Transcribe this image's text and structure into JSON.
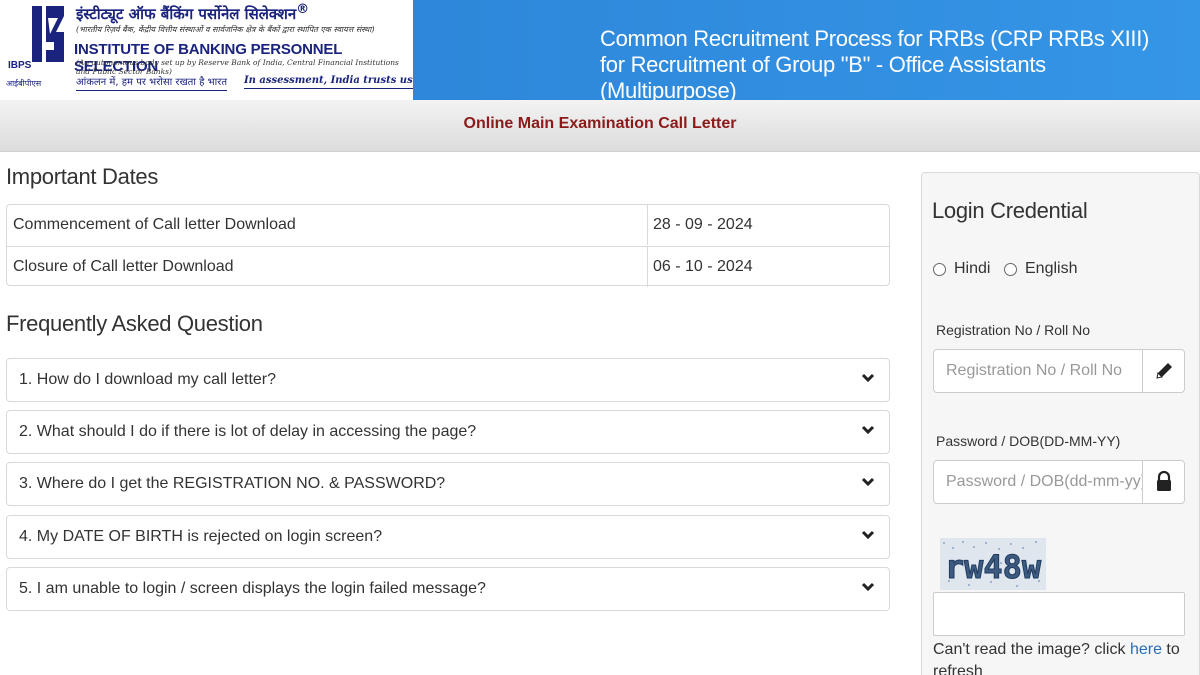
{
  "header": {
    "logo": {
      "hindi_name": "इंस्टीट्यूट ऑफ बैंकिंग पर्सोनेल सिलेक्शन",
      "registered_mark": "®",
      "hindi_subtitle": "(भारतीय रिज़र्व बैंक, केंद्रीय वित्तीय संस्थाओं व सार्वजनिक क्षेत्र के बैंकों द्वारा स्थापित एक स्वायत्त संस्था)",
      "english_name": "INSTITUTE OF BANKING PERSONNEL SELECTION",
      "english_subtitle": "(An autonomous body set up by Reserve Bank of India, Central Financial Institutions and Public Sector Banks)",
      "hindi_tagline": "आंकलन में, हम पर भरोसा रखता है भारत",
      "english_tagline": "In assessment, India trusts us",
      "short_name": "IBPS",
      "short_name_hindi": "आईबीपीएस"
    },
    "title": "Common Recruitment Process for RRBs (CRP RRBs XIII) for Recruitment of Group \"B\" - Office Assistants (Multipurpose)"
  },
  "subheader": {
    "title": "Online Main Examination Call Letter"
  },
  "important_dates": {
    "heading": "Important Dates",
    "rows": [
      {
        "label": "Commencement of Call letter Download",
        "date": "28 - 09 - 2024"
      },
      {
        "label": "Closure of Call letter Download",
        "date": "06 - 10 - 2024"
      }
    ]
  },
  "faq": {
    "heading": "Frequently Asked Question",
    "items": [
      "1. How do I download my call letter?",
      "2. What should I do if there is lot of delay in accessing the page?",
      "3. Where do I get the REGISTRATION NO. & PASSWORD?",
      "4. My DATE OF BIRTH is rejected on login screen?",
      "5. I am unable to login / screen displays the login failed message?"
    ],
    "expand_icon": "chevron-down-icon"
  },
  "login": {
    "heading": "Login Credential",
    "languages": [
      "Hindi",
      "English"
    ],
    "registration": {
      "label": "Registration No / Roll No",
      "placeholder": "Registration No / Roll No",
      "icon": "pencil-icon"
    },
    "password": {
      "label": "Password / DOB(DD-MM-YY)",
      "placeholder": "Password / DOB(dd-mm-yy)",
      "icon": "lock-icon"
    },
    "captcha_text": "rw48w",
    "cant_read_prefix": "Can't read the image? click ",
    "here_link": "here",
    "cant_read_suffix": " to refresh"
  },
  "colors": {
    "header_blue": "#3595e6",
    "subheader_title": "#8b1a1a",
    "logo_navy": "#1a237e",
    "link": "#2a6db5"
  }
}
